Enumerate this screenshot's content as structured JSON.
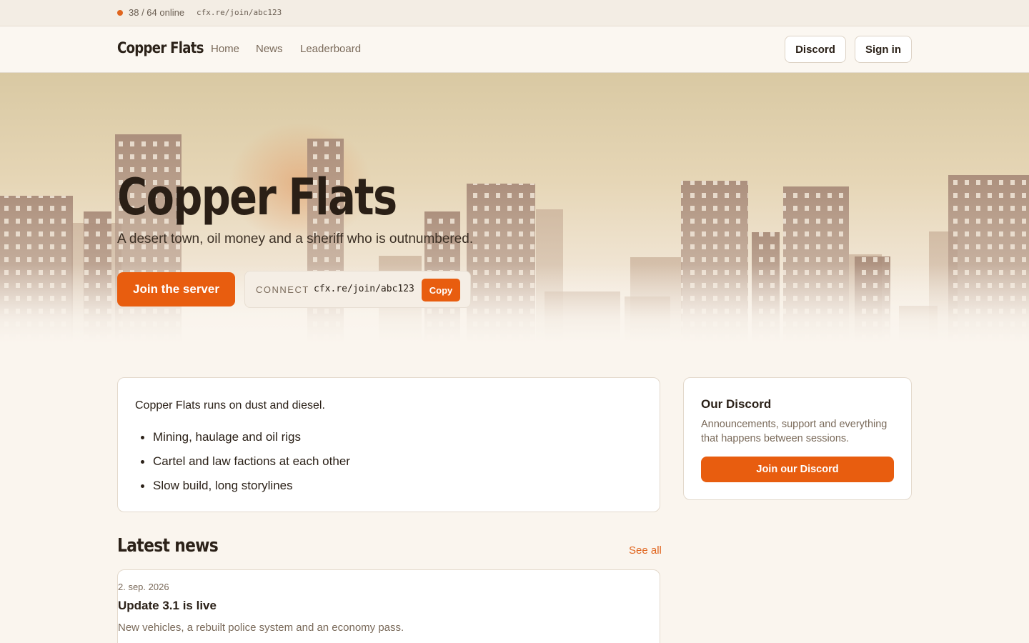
{
  "status": {
    "online": "38 / 64 online",
    "address": "cfx.re/join/abc123"
  },
  "header": {
    "brand": "Copper Flats",
    "nav": [
      "Home",
      "News",
      "Leaderboard"
    ],
    "discord_label": "Discord",
    "signin_label": "Sign in"
  },
  "hero": {
    "title": "Copper Flats",
    "subtitle": "A desert town, oil money and a sheriff who is outnumbered.",
    "join_label": "Join the server",
    "connect_label": "CONNECT",
    "connect_address": "cfx.re/join/abc123",
    "copy_label": "Copy"
  },
  "about": {
    "intro": "Copper Flats runs on dust and diesel.",
    "items": [
      "Mining, haulage and oil rigs",
      "Cartel and law factions at each other",
      "Slow build, long storylines"
    ]
  },
  "discord_card": {
    "title": "Our Discord",
    "text": "Announcements, support and everything that happens between sessions.",
    "button": "Join our Discord"
  },
  "news": {
    "heading": "Latest news",
    "see_all": "See all",
    "items": [
      {
        "date": "2. sep. 2026",
        "title": "Update 3.1 is live",
        "excerpt": "New vehicles, a rebuilt police system and an economy pass."
      }
    ]
  },
  "colors": {
    "accent": "#e85d0f",
    "status_dot": "#e0651e",
    "background": "#faf5ee",
    "text": "#2b2118",
    "muted": "#7a6a5a"
  }
}
